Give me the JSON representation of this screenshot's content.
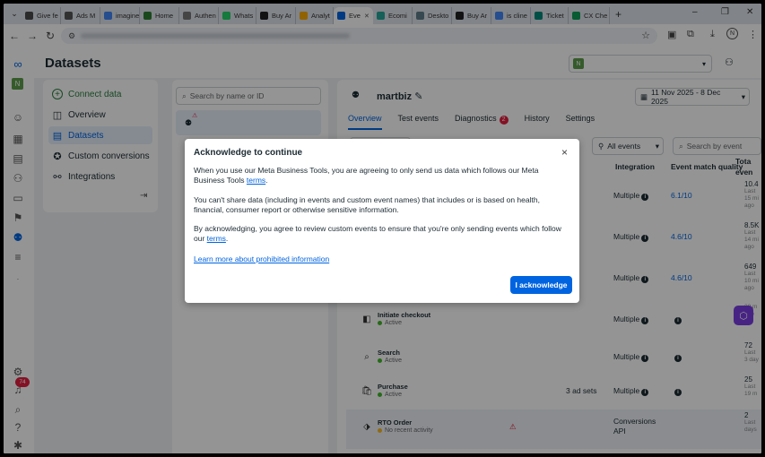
{
  "browser": {
    "tabs": [
      {
        "label": "Give fe",
        "color": "#4a4a4a"
      },
      {
        "label": "Ads M",
        "color": "#555"
      },
      {
        "label": "imagine",
        "color": "#4285f4"
      },
      {
        "label": "Home",
        "color": "#2e7d32"
      },
      {
        "label": "Authen",
        "color": "#777"
      },
      {
        "label": "Whats",
        "color": "#25d366"
      },
      {
        "label": "Buy Ar",
        "color": "#222"
      },
      {
        "label": "Analyt",
        "color": "#f9ab00"
      },
      {
        "label": "Eve",
        "color": "#0064e0"
      },
      {
        "label": "Ecomi",
        "color": "#26a69a"
      },
      {
        "label": "Deskto",
        "color": "#607d8b"
      },
      {
        "label": "Buy Ar",
        "color": "#222"
      },
      {
        "label": "is cline",
        "color": "#4285f4"
      },
      {
        "label": "Ticket",
        "color": "#00897b"
      },
      {
        "label": "CX Che",
        "color": "#0f9d58"
      }
    ],
    "active_tab": 8,
    "new_tab": "+"
  },
  "app": {
    "title": "Datasets",
    "account_badge": "N",
    "notification_count": "74"
  },
  "left_nav": {
    "connect": "Connect data",
    "items": [
      {
        "label": "Overview",
        "icon": "overview-icon"
      },
      {
        "label": "Datasets",
        "icon": "datasets-icon"
      },
      {
        "label": "Custom conversions",
        "icon": "custom-conversions-icon"
      },
      {
        "label": "Integrations",
        "icon": "integrations-icon"
      }
    ]
  },
  "list": {
    "search_placeholder": "Search by name or ID"
  },
  "dataset": {
    "name": "martbiz",
    "date_range": "11 Nov 2025 - 8 Dec 2025",
    "tabs": [
      "Overview",
      "Test events",
      "Diagnostics",
      "History",
      "Settings"
    ],
    "diagnostics_count": "2",
    "filter_events": "All events",
    "search_event_placeholder": "Search by event"
  },
  "table": {
    "headers": {
      "integration": "Integration",
      "emq": "Event match quality",
      "total": "Tota",
      "total2": "even"
    },
    "rows": [
      {
        "name": "",
        "status": "",
        "count": "",
        "integration": "Multiple",
        "emq": "6.1/10",
        "total": "10.4",
        "t1": "Last",
        "t2": "15 mi",
        "t3": "ago"
      },
      {
        "name": "",
        "status": "",
        "count": "",
        "integration": "Multiple",
        "emq": "4.6/10",
        "total": "8.5K",
        "t1": "Last",
        "t2": "14 mi",
        "t3": "ago"
      },
      {
        "name": "",
        "status": "",
        "count": "",
        "integration": "Multiple",
        "emq": "4.6/10",
        "total": "649",
        "t1": "Last",
        "t2": "10 mi",
        "t3": "ago"
      },
      {
        "name": "Initiate checkout",
        "status": "Active",
        "count": "",
        "integration": "Multiple",
        "emq": "",
        "total": "",
        "t1": "",
        "t2": "28 m",
        "t3": "ago"
      },
      {
        "name": "Search",
        "status": "Active",
        "count": "",
        "integration": "Multiple",
        "emq": "",
        "total": "72",
        "t1": "Last",
        "t2": "3 day",
        "t3": ""
      },
      {
        "name": "Purchase",
        "status": "Active",
        "count": "3 ad sets",
        "integration": "Multiple",
        "emq": "",
        "total": "25",
        "t1": "Last",
        "t2": "19 m",
        "t3": ""
      },
      {
        "name": "RTO Order",
        "status": "No recent activity",
        "count": "",
        "integration": "Conversions",
        "integration2": "API",
        "emq": "",
        "total": "2",
        "t1": "Last",
        "t2": "days",
        "t3": ""
      }
    ]
  },
  "modal": {
    "title": "Acknowledge to continue",
    "p1": "When you use our Meta Business Tools, you are agreeing to only send us data which follows our Meta Business Tools",
    "p1_link": "terms",
    "p1_end": ".",
    "p2": "You can't share data (including in events and custom event names) that includes or is based on health, financial, consumer report or otherwise sensitive information.",
    "p3": "By acknowledging, you agree to review custom events to ensure that you're only sending events which follow our",
    "p3_link": "terms",
    "p3_end": ".",
    "learn_more": "Learn more about prohibited information",
    "button": "I acknowledge",
    "close": "×"
  },
  "colors": {
    "accent": "#0064e0",
    "active_green": "#42b72a",
    "warn": "#f7b928",
    "error": "#e41e3f"
  }
}
